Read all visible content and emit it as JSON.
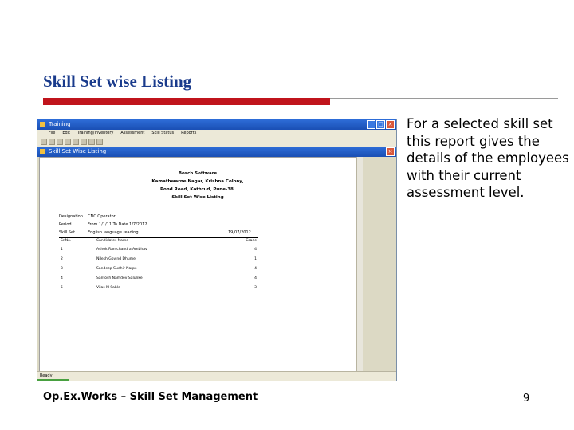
{
  "slide": {
    "title": "Skill Set wise Listing",
    "description": "For a selected skill set this report gives the details of the employees with their current assessment level.",
    "footer_left": "Op.Ex.Works – Skill Set Management",
    "page_number": "9"
  },
  "colors": {
    "title": "#1a3b8c",
    "accent_rule": "#c0141c"
  },
  "screenshot": {
    "outer_title": "Training",
    "inner_title": "Skill Set Wise Listing",
    "menu": [
      "File",
      "Edit",
      "Training/Inventory",
      "Assessment",
      "Skill Status",
      "Reports"
    ],
    "status_text": "Ready",
    "report": {
      "company": "Bosch Software",
      "address_lines": [
        "Kamathwarne Nagar, Krishna Colony,",
        "Pond Road, Kothrud, Pune-38."
      ],
      "heading": "Skill Set Wise Listing",
      "designation_label": "Designation :",
      "designation_value": "CNC Operator",
      "period_label": "Period",
      "period_value": "From 1/1/11 To Date 1/7/2012",
      "skill_set_label": "Skill Set",
      "skill_set_value": "English language reading",
      "date": "19/07/2012",
      "columns": [
        "Sr.No.",
        "Candidates Name",
        "Grade"
      ],
      "rows": [
        {
          "sr": "1",
          "name": "Ashok Ramchandra Ambhav",
          "grade": "4"
        },
        {
          "sr": "2",
          "name": "Nilesh Govind Dhume",
          "grade": "1"
        },
        {
          "sr": "3",
          "name": "Sandeep Sudhir Narpe",
          "grade": "4"
        },
        {
          "sr": "4",
          "name": "Santosh Namdev Salunke",
          "grade": "4"
        },
        {
          "sr": "5",
          "name": "Vilas M Sable",
          "grade": "3"
        }
      ]
    }
  }
}
